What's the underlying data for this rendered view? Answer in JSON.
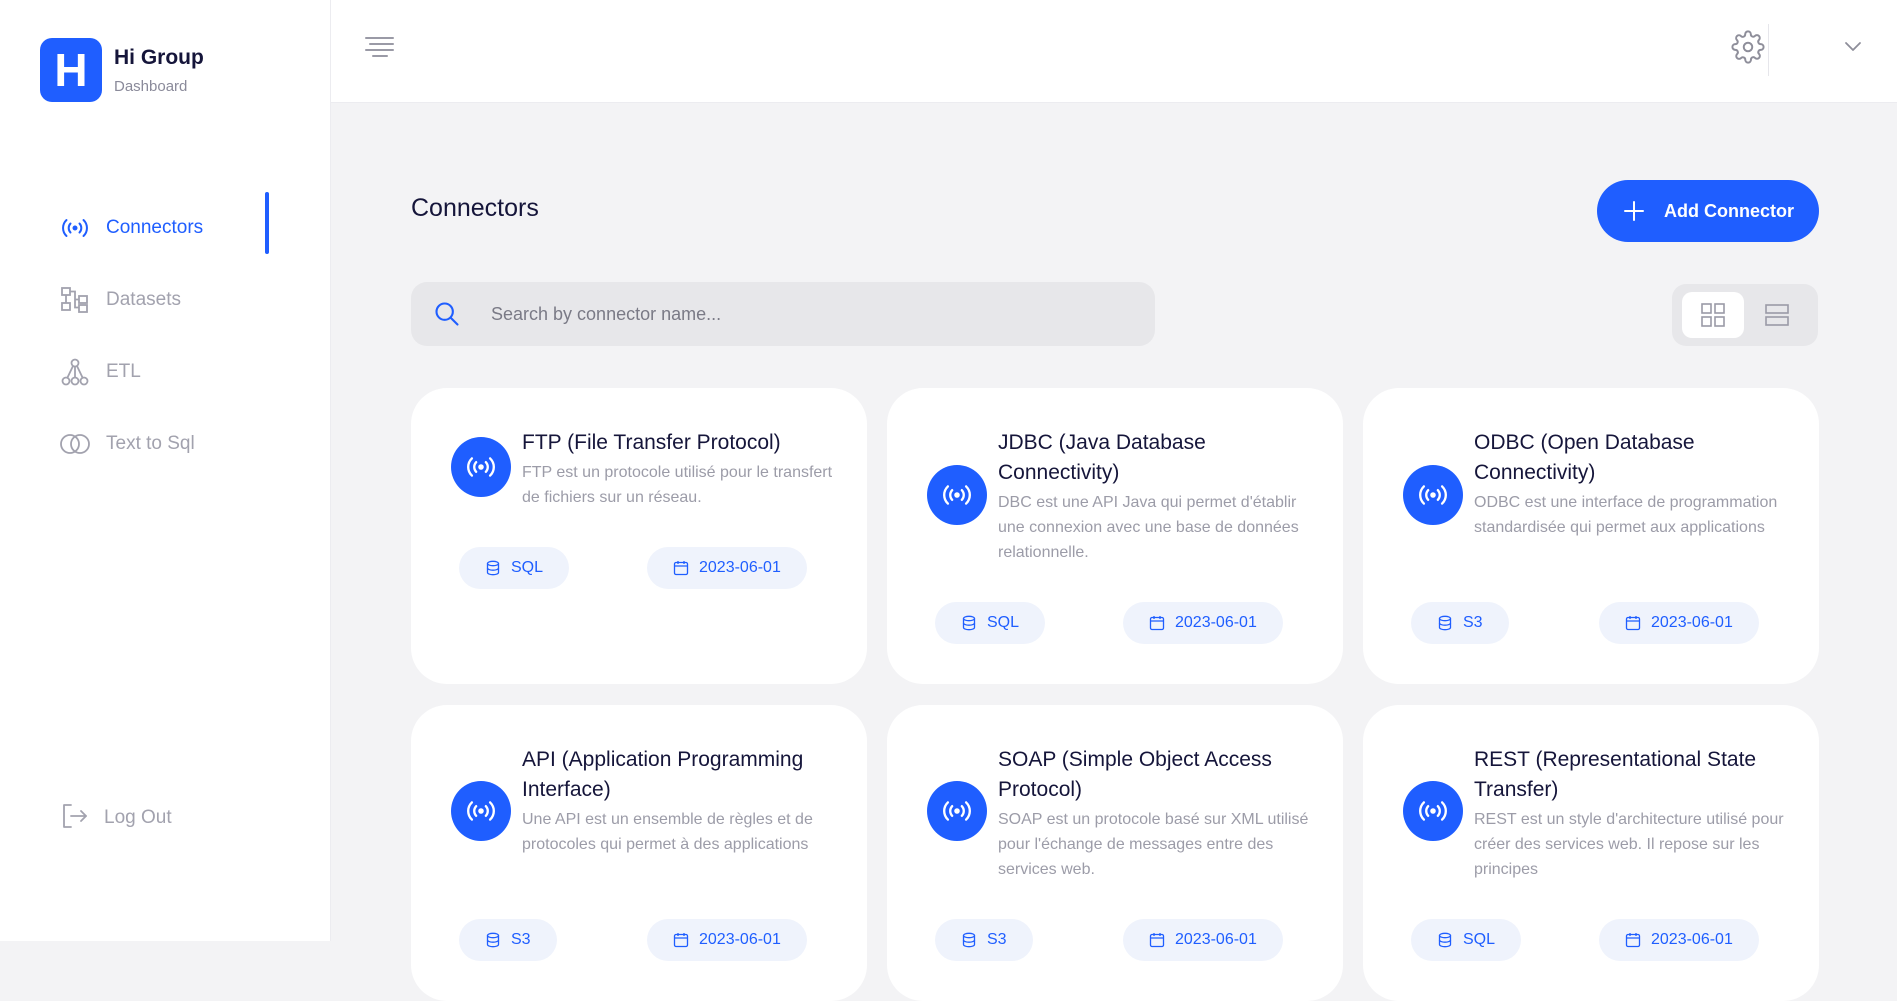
{
  "brand": {
    "logo_letter": "H",
    "title": "Hi Group",
    "subtitle": "Dashboard"
  },
  "sidebar": {
    "items": [
      {
        "label": "Connectors",
        "icon": "broadcast-icon",
        "active": true
      },
      {
        "label": "Datasets",
        "icon": "dataset-icon",
        "active": false
      },
      {
        "label": "ETL",
        "icon": "etl-icon",
        "active": false
      },
      {
        "label": "Text to Sql",
        "icon": "text-to-sql-icon",
        "active": false
      }
    ],
    "logout_label": "Log Out"
  },
  "main": {
    "title": "Connectors",
    "add_button_label": "Add Connector",
    "search_placeholder": "Search by connector name..."
  },
  "connectors": [
    {
      "title": "FTP (File Transfer Protocol)",
      "description": "FTP est un protocole utilisé pour le transfert de fichiers sur un réseau.",
      "type": "SQL",
      "date": "2023-06-01"
    },
    {
      "title": "JDBC (Java Database Connectivity)",
      "description": "DBC est une API Java qui permet d'établir une connexion avec une base de données relationnelle.",
      "type": "SQL",
      "date": "2023-06-01"
    },
    {
      "title": "ODBC (Open Database Connectivity)",
      "description": "ODBC est une interface de programmation standardisée qui permet aux applications",
      "type": "S3",
      "date": "2023-06-01"
    },
    {
      "title": "API (Application Programming Interface)",
      "description": "Une API est un ensemble de règles et de protocoles qui permet à des applications",
      "type": "S3",
      "date": "2023-06-01"
    },
    {
      "title": "SOAP (Simple Object Access Protocol)",
      "description": "SOAP est un protocole basé sur XML utilisé pour l'échange de messages entre des services web.",
      "type": "S3",
      "date": "2023-06-01"
    },
    {
      "title": "REST (Representational State Transfer)",
      "description": "REST est un style d'architecture utilisé pour créer des services web. Il repose sur les principes",
      "type": "SQL",
      "date": "2023-06-01"
    }
  ],
  "colors": {
    "accent": "#1f5eff",
    "background": "#f3f3f5",
    "card": "#ffffff",
    "pill": "#eff3fc"
  }
}
